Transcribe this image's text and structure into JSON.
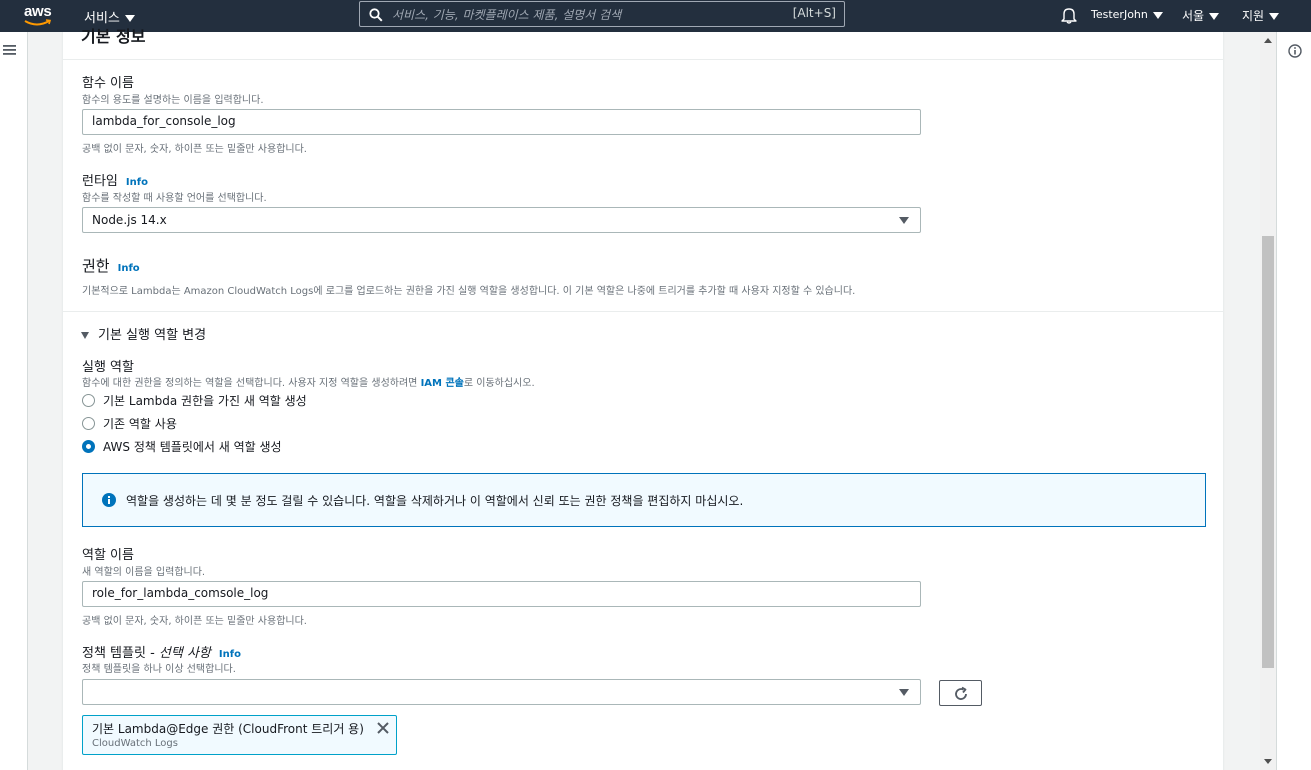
{
  "topnav": {
    "logo_text": "aws",
    "services_label": "서비스",
    "search_placeholder": "서비스, 기능, 마켓플레이스 제품, 설명서 검색",
    "search_shortcut": "[Alt+S]",
    "user_label": "TesterJohn",
    "region_label": "서울",
    "support_label": "지원"
  },
  "header": {
    "clipped_title": "기본 정보"
  },
  "function_name": {
    "label": "함수 이름",
    "description": "함수의 용도를 설명하는 이름을 입력합니다.",
    "value": "lambda_for_console_log",
    "hint": "공백 없이 문자, 숫자, 하이픈 또는 밑줄만 사용합니다."
  },
  "runtime": {
    "label": "런타임",
    "info": "Info",
    "description": "함수를 작성할 때 사용할 언어를 선택합니다.",
    "selected": "Node.js 14.x"
  },
  "permissions": {
    "title": "권한",
    "info": "Info",
    "description": "기본적으로 Lambda는 Amazon CloudWatch Logs에 로그를 업로드하는 권한을 가진 실행 역할을 생성합니다. 이 기본 역할은 나중에 트리거를 추가할 때 사용자 지정할 수 있습니다."
  },
  "expander": {
    "label": "기본 실행 역할 변경"
  },
  "execution_role": {
    "label": "실행 역할",
    "description_prefix": "함수에 대한 권한을 정의하는 역할을 선택합니다. 사용자 지정 역할을 생성하려면 ",
    "iam_link": "IAM 콘솔",
    "description_suffix": "로 이동하십시오.",
    "options": [
      {
        "label": "기본 Lambda 권한을 가진 새 역할 생성",
        "selected": false
      },
      {
        "label": "기존 역할 사용",
        "selected": false
      },
      {
        "label": "AWS 정책 템플릿에서 새 역할 생성",
        "selected": true
      }
    ]
  },
  "alert": {
    "message": "역할을 생성하는 데 몇 분 정도 걸릴 수 있습니다. 역할을 삭제하거나 이 역할에서 신뢰 또는 권한 정책을 편집하지 마십시오.",
    "icon": "info-icon"
  },
  "role_name": {
    "label": "역할 이름",
    "description": "새 역할의 이름을 입력합니다.",
    "value": "role_for_lambda_comsole_log",
    "hint": "공백 없이 문자, 숫자, 하이픈 또는 밑줄만 사용합니다."
  },
  "policy_templates": {
    "label": "정책 템플릿 - ",
    "label_optional": "선택 사항",
    "info": "Info",
    "description": "정책 템플릿을 하나 이상 선택합니다.",
    "selected_value": ""
  },
  "token": {
    "name": "기본 Lambda@Edge 권한 (CloudFront 트리거 용)",
    "description": "CloudWatch Logs"
  },
  "colors": {
    "nav_bg": "#232f3e",
    "link": "#0073bb",
    "alert_bg": "#f1faff",
    "token_border": "#00a1c9"
  }
}
